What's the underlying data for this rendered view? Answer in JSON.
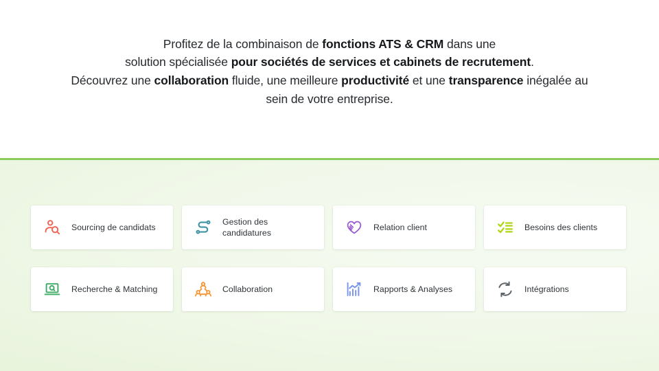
{
  "intro": {
    "line1_a": "Profitez de la combinaison de ",
    "line1_b": "fonctions ATS & CRM",
    "line1_c": " dans une",
    "line2_a": "solution spécialisée ",
    "line2_b": "pour sociétés de services et cabinets de recrutement",
    "line2_c": ".",
    "line3_a": "Découvrez une ",
    "line3_b": "collaboration",
    "line3_c": " fluide, une meilleure ",
    "line3_d": "productivité",
    "line3_e": " et une ",
    "line3_f": "transparence",
    "line3_g": " inégalée au",
    "line4": "sein de votre entreprise."
  },
  "divider": {
    "color": "#8bcc5f"
  },
  "features": {
    "cards": [
      {
        "label": "Sourcing de candidats",
        "icon": "person-search-icon",
        "color": "#ef6152"
      },
      {
        "label": "Gestion des candidatures",
        "icon": "workflow-path-icon",
        "color": "#3d93a5"
      },
      {
        "label": "Relation client",
        "icon": "handshake-heart-icon",
        "color": "#9b59d0"
      },
      {
        "label": "Besoins des clients",
        "icon": "checklist-icon",
        "color": "#aed613"
      },
      {
        "label": "Recherche & Matching",
        "icon": "laptop-search-icon",
        "color": "#3aaa64"
      },
      {
        "label": "Collaboration",
        "icon": "team-collaboration-icon",
        "color": "#f59331"
      },
      {
        "label": "Rapports & Analyses",
        "icon": "bar-chart-trend-icon",
        "color": "#7b95ef"
      },
      {
        "label": "Intégrations",
        "icon": "sync-arrows-icon",
        "color": "#5e6468"
      }
    ]
  }
}
